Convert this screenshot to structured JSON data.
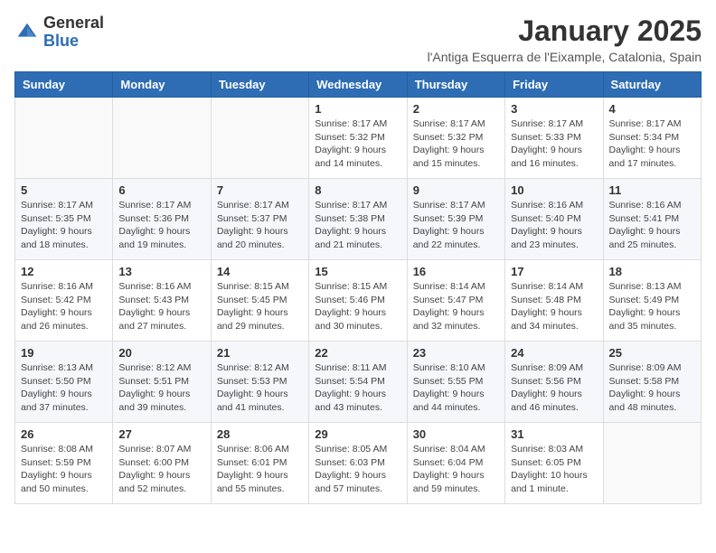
{
  "logo": {
    "general": "General",
    "blue": "Blue"
  },
  "header": {
    "month": "January 2025",
    "location": "l'Antiga Esquerra de l'Eixample, Catalonia, Spain"
  },
  "weekdays": [
    "Sunday",
    "Monday",
    "Tuesday",
    "Wednesday",
    "Thursday",
    "Friday",
    "Saturday"
  ],
  "weeks": [
    [
      {
        "day": "",
        "sunrise": "",
        "sunset": "",
        "daylight": ""
      },
      {
        "day": "",
        "sunrise": "",
        "sunset": "",
        "daylight": ""
      },
      {
        "day": "",
        "sunrise": "",
        "sunset": "",
        "daylight": ""
      },
      {
        "day": "1",
        "sunrise": "Sunrise: 8:17 AM",
        "sunset": "Sunset: 5:32 PM",
        "daylight": "Daylight: 9 hours and 14 minutes."
      },
      {
        "day": "2",
        "sunrise": "Sunrise: 8:17 AM",
        "sunset": "Sunset: 5:32 PM",
        "daylight": "Daylight: 9 hours and 15 minutes."
      },
      {
        "day": "3",
        "sunrise": "Sunrise: 8:17 AM",
        "sunset": "Sunset: 5:33 PM",
        "daylight": "Daylight: 9 hours and 16 minutes."
      },
      {
        "day": "4",
        "sunrise": "Sunrise: 8:17 AM",
        "sunset": "Sunset: 5:34 PM",
        "daylight": "Daylight: 9 hours and 17 minutes."
      }
    ],
    [
      {
        "day": "5",
        "sunrise": "Sunrise: 8:17 AM",
        "sunset": "Sunset: 5:35 PM",
        "daylight": "Daylight: 9 hours and 18 minutes."
      },
      {
        "day": "6",
        "sunrise": "Sunrise: 8:17 AM",
        "sunset": "Sunset: 5:36 PM",
        "daylight": "Daylight: 9 hours and 19 minutes."
      },
      {
        "day": "7",
        "sunrise": "Sunrise: 8:17 AM",
        "sunset": "Sunset: 5:37 PM",
        "daylight": "Daylight: 9 hours and 20 minutes."
      },
      {
        "day": "8",
        "sunrise": "Sunrise: 8:17 AM",
        "sunset": "Sunset: 5:38 PM",
        "daylight": "Daylight: 9 hours and 21 minutes."
      },
      {
        "day": "9",
        "sunrise": "Sunrise: 8:17 AM",
        "sunset": "Sunset: 5:39 PM",
        "daylight": "Daylight: 9 hours and 22 minutes."
      },
      {
        "day": "10",
        "sunrise": "Sunrise: 8:16 AM",
        "sunset": "Sunset: 5:40 PM",
        "daylight": "Daylight: 9 hours and 23 minutes."
      },
      {
        "day": "11",
        "sunrise": "Sunrise: 8:16 AM",
        "sunset": "Sunset: 5:41 PM",
        "daylight": "Daylight: 9 hours and 25 minutes."
      }
    ],
    [
      {
        "day": "12",
        "sunrise": "Sunrise: 8:16 AM",
        "sunset": "Sunset: 5:42 PM",
        "daylight": "Daylight: 9 hours and 26 minutes."
      },
      {
        "day": "13",
        "sunrise": "Sunrise: 8:16 AM",
        "sunset": "Sunset: 5:43 PM",
        "daylight": "Daylight: 9 hours and 27 minutes."
      },
      {
        "day": "14",
        "sunrise": "Sunrise: 8:15 AM",
        "sunset": "Sunset: 5:45 PM",
        "daylight": "Daylight: 9 hours and 29 minutes."
      },
      {
        "day": "15",
        "sunrise": "Sunrise: 8:15 AM",
        "sunset": "Sunset: 5:46 PM",
        "daylight": "Daylight: 9 hours and 30 minutes."
      },
      {
        "day": "16",
        "sunrise": "Sunrise: 8:14 AM",
        "sunset": "Sunset: 5:47 PM",
        "daylight": "Daylight: 9 hours and 32 minutes."
      },
      {
        "day": "17",
        "sunrise": "Sunrise: 8:14 AM",
        "sunset": "Sunset: 5:48 PM",
        "daylight": "Daylight: 9 hours and 34 minutes."
      },
      {
        "day": "18",
        "sunrise": "Sunrise: 8:13 AM",
        "sunset": "Sunset: 5:49 PM",
        "daylight": "Daylight: 9 hours and 35 minutes."
      }
    ],
    [
      {
        "day": "19",
        "sunrise": "Sunrise: 8:13 AM",
        "sunset": "Sunset: 5:50 PM",
        "daylight": "Daylight: 9 hours and 37 minutes."
      },
      {
        "day": "20",
        "sunrise": "Sunrise: 8:12 AM",
        "sunset": "Sunset: 5:51 PM",
        "daylight": "Daylight: 9 hours and 39 minutes."
      },
      {
        "day": "21",
        "sunrise": "Sunrise: 8:12 AM",
        "sunset": "Sunset: 5:53 PM",
        "daylight": "Daylight: 9 hours and 41 minutes."
      },
      {
        "day": "22",
        "sunrise": "Sunrise: 8:11 AM",
        "sunset": "Sunset: 5:54 PM",
        "daylight": "Daylight: 9 hours and 43 minutes."
      },
      {
        "day": "23",
        "sunrise": "Sunrise: 8:10 AM",
        "sunset": "Sunset: 5:55 PM",
        "daylight": "Daylight: 9 hours and 44 minutes."
      },
      {
        "day": "24",
        "sunrise": "Sunrise: 8:09 AM",
        "sunset": "Sunset: 5:56 PM",
        "daylight": "Daylight: 9 hours and 46 minutes."
      },
      {
        "day": "25",
        "sunrise": "Sunrise: 8:09 AM",
        "sunset": "Sunset: 5:58 PM",
        "daylight": "Daylight: 9 hours and 48 minutes."
      }
    ],
    [
      {
        "day": "26",
        "sunrise": "Sunrise: 8:08 AM",
        "sunset": "Sunset: 5:59 PM",
        "daylight": "Daylight: 9 hours and 50 minutes."
      },
      {
        "day": "27",
        "sunrise": "Sunrise: 8:07 AM",
        "sunset": "Sunset: 6:00 PM",
        "daylight": "Daylight: 9 hours and 52 minutes."
      },
      {
        "day": "28",
        "sunrise": "Sunrise: 8:06 AM",
        "sunset": "Sunset: 6:01 PM",
        "daylight": "Daylight: 9 hours and 55 minutes."
      },
      {
        "day": "29",
        "sunrise": "Sunrise: 8:05 AM",
        "sunset": "Sunset: 6:03 PM",
        "daylight": "Daylight: 9 hours and 57 minutes."
      },
      {
        "day": "30",
        "sunrise": "Sunrise: 8:04 AM",
        "sunset": "Sunset: 6:04 PM",
        "daylight": "Daylight: 9 hours and 59 minutes."
      },
      {
        "day": "31",
        "sunrise": "Sunrise: 8:03 AM",
        "sunset": "Sunset: 6:05 PM",
        "daylight": "Daylight: 10 hours and 1 minute."
      },
      {
        "day": "",
        "sunrise": "",
        "sunset": "",
        "daylight": ""
      }
    ]
  ]
}
